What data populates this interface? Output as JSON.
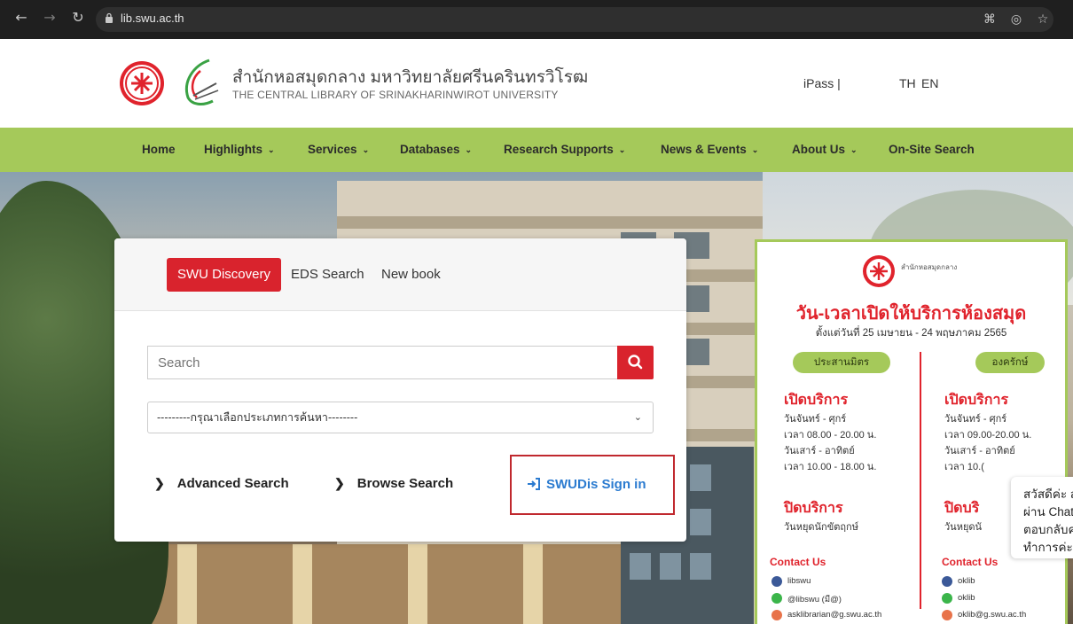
{
  "browser": {
    "url": "lib.swu.ac.th"
  },
  "header": {
    "title_th": "สำนักหอสมุดกลาง มหาวิทยาลัยศรีนครินทรวิโรฒ",
    "title_en": "THE CENTRAL LIBRARY OF SRINAKHARINWIROT UNIVERSITY",
    "ipass_label": "iPass |",
    "lang_th": "TH",
    "lang_en": "EN"
  },
  "nav": {
    "items": [
      {
        "label": "Home",
        "dropdown": false
      },
      {
        "label": "Highlights",
        "dropdown": true
      },
      {
        "label": "Services",
        "dropdown": true
      },
      {
        "label": "Databases",
        "dropdown": true
      },
      {
        "label": "Research Supports",
        "dropdown": true
      },
      {
        "label": "News & Events",
        "dropdown": true
      },
      {
        "label": "About Us",
        "dropdown": true
      },
      {
        "label": "On-Site Search",
        "dropdown": false
      }
    ],
    "chevron": "⌄"
  },
  "search": {
    "tabs": [
      "SWU Discovery",
      "EDS Search",
      "New book"
    ],
    "active_tab": "SWU Discovery",
    "placeholder": "Search",
    "select_value": "---------กรุณาเลือกประเภทการค้นหา--------",
    "advanced_label": "Advanced Search",
    "browse_label": "Browse Search",
    "signin_label": "SWUDis Sign in"
  },
  "poster": {
    "org": "สำนักหอสมุดกลาง",
    "title": "วัน-เวลาเปิดให้บริการห้องสมุด",
    "subtitle": "ตั้งแต่วันที่ 25 เมษายน - 24 พฤษภาคม 2565",
    "left": {
      "campus": "ประสานมิตร",
      "open_head": "เปิดบริการ",
      "lines": [
        "วันจันทร์ - ศุกร์",
        "เวลา 08.00 - 20.00 น.",
        "วันเสาร์ - อาทิตย์",
        "เวลา 10.00 - 18.00 น."
      ],
      "close_head": "ปิดบริการ",
      "close_line": "วันหยุดนักขัตฤกษ์"
    },
    "right": {
      "campus": "องครักษ์",
      "open_head": "เปิดบริการ",
      "lines": [
        "วันจันทร์ - ศุกร์",
        "เวลา 09.00-20.00 น.",
        "วันเสาร์ - อาทิตย์",
        "เวลา 10.("
      ],
      "close_head": "ปิดบริ",
      "close_line": "วันหยุดนั"
    },
    "contact_label": "Contact Us",
    "left_contacts": [
      "libswu",
      "@libswu (มี@)",
      "asklibrarian@g.swu.ac.th"
    ],
    "right_contacts": [
      "oklib",
      "oklib",
      "oklib@g.swu.ac.th"
    ]
  },
  "chat": {
    "lines": [
      "สวัสดีค่ะ สอ",
      "ผ่าน Chat ร",
      "ตอบกลับคุณ",
      "ทำการค่ะ"
    ]
  },
  "colors": {
    "nav_green": "#a5c95a",
    "accent_red": "#d9232d",
    "link_blue": "#2b7bd0"
  }
}
